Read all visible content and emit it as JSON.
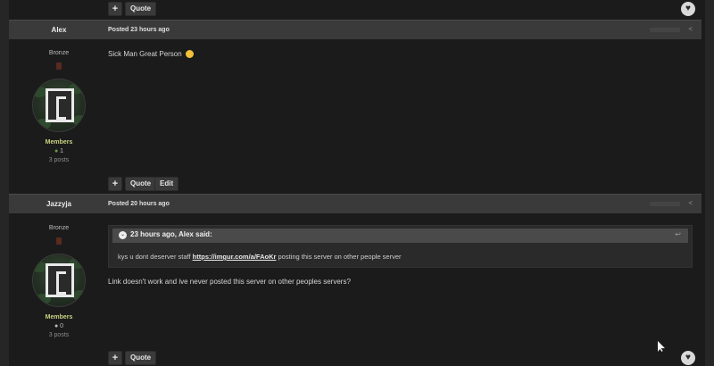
{
  "top_actions": {
    "plus_label": "+",
    "quote_label": "Quote"
  },
  "posts": [
    {
      "author": "Alex",
      "posted": "Posted 23 hours ago",
      "rank": "Bronze",
      "group": "Members",
      "reputation": "1",
      "post_count": "3 posts",
      "content": "Sick Man Great Person",
      "actions": {
        "plus_label": "+",
        "quote_label": "Quote",
        "edit_label": "Edit"
      }
    },
    {
      "author": "Jazzyja",
      "posted": "Posted 20 hours ago",
      "rank": "Bronze",
      "group": "Members",
      "reputation": "0",
      "post_count": "3 posts",
      "quote": {
        "title": "23 hours ago, Alex said:",
        "text_before": "kys u dont deserver staff ",
        "link_text": "https://imgur.com/a/FAoKr",
        "text_after": " posting this server on other people server"
      },
      "content": "Link doesn't work and ive never posted this server on other peoples servers?",
      "actions": {
        "plus_label": "+",
        "quote_label": "Quote"
      }
    }
  ],
  "icons": {
    "heart": "♥",
    "share": "<",
    "toggle": "⌄",
    "quote_link": "↩",
    "rep_dot": "●"
  },
  "colors": {
    "background": "#1b1b1b",
    "header": "#3a3a3a",
    "group_color": "#c9d180",
    "rep_positive": "#6c9a4c"
  }
}
